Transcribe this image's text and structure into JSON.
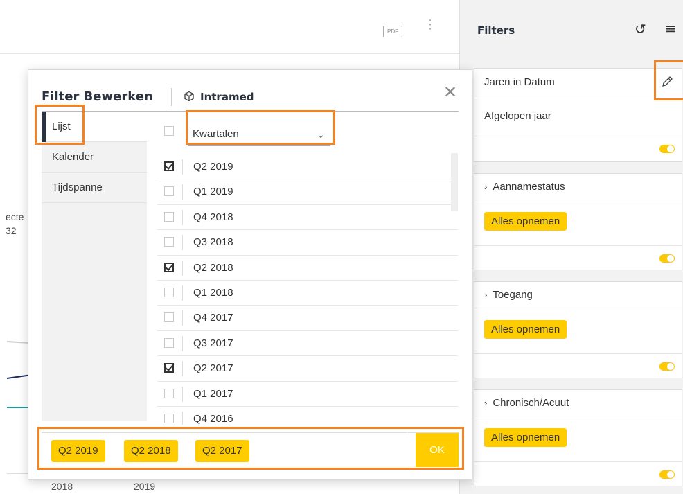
{
  "toolbar": {
    "pdf_label": "PDF",
    "more_icon": "kebab-icon"
  },
  "background": {
    "chart_fragment_line1": "ecte",
    "chart_fragment_line2": "32",
    "x_ticks": [
      "2018",
      "2019"
    ]
  },
  "filters_panel": {
    "title": "Filters",
    "reset_icon": "reset-icon",
    "menu_icon": "menu-icon",
    "cards": [
      {
        "label": "Jaren in Datum",
        "value": "Afgelopen jaar",
        "edit_icon": "pencil-icon"
      },
      {
        "label": "Aannamestatus",
        "chip": "Alles opnemen"
      },
      {
        "label": "Toegang",
        "chip": "Alles opnemen"
      },
      {
        "label": "Chronisch/Acuut",
        "chip": "Alles opnemen"
      }
    ]
  },
  "modal": {
    "title": "Filter Bewerken",
    "datasource": "Intramed",
    "tabs": [
      "Lijst",
      "Kalender",
      "Tijdspanne"
    ],
    "dropdown_value": "Kwartalen",
    "items": [
      {
        "label": "Q2 2019",
        "checked": true
      },
      {
        "label": "Q1 2019",
        "checked": false
      },
      {
        "label": "Q4 2018",
        "checked": false
      },
      {
        "label": "Q3 2018",
        "checked": false
      },
      {
        "label": "Q2 2018",
        "checked": true
      },
      {
        "label": "Q1 2018",
        "checked": false
      },
      {
        "label": "Q4 2017",
        "checked": false
      },
      {
        "label": "Q3 2017",
        "checked": false
      },
      {
        "label": "Q2 2017",
        "checked": true
      },
      {
        "label": "Q1 2017",
        "checked": false
      },
      {
        "label": "Q4 2016",
        "checked": false
      }
    ],
    "selected": [
      "Q2 2019",
      "Q2 2018",
      "Q2 2017"
    ],
    "ok_label": "OK"
  },
  "colors": {
    "accent_yellow": "#ffcc00",
    "highlight_orange": "#f58220",
    "navy": "#2b3240"
  }
}
